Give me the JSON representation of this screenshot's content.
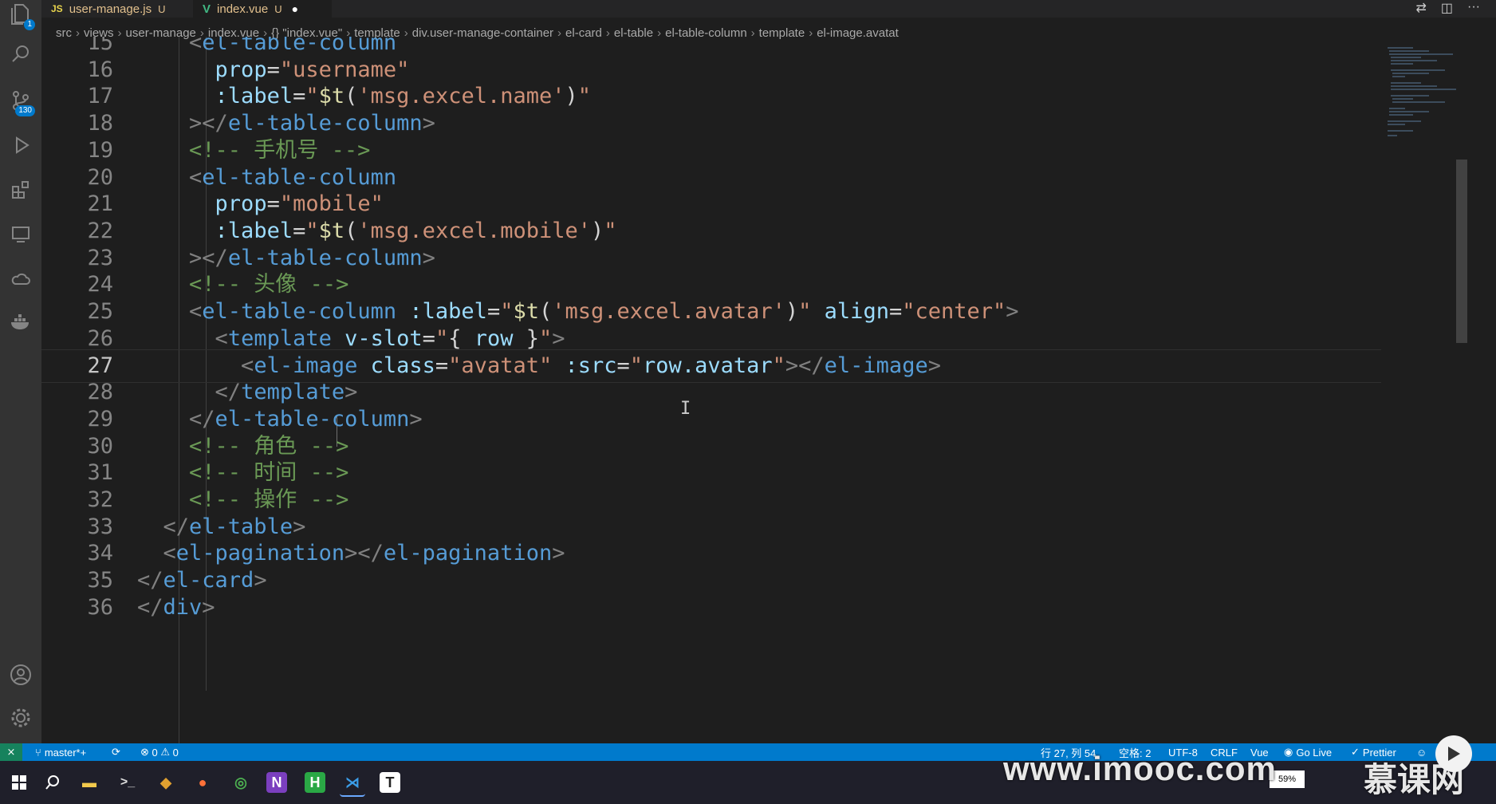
{
  "tabs": [
    {
      "name": "user-manage.js",
      "status": "U",
      "icon": "js",
      "active": false
    },
    {
      "name": "index.vue",
      "status": "U",
      "icon": "vue",
      "active": true,
      "modified": true
    }
  ],
  "breadcrumb": [
    "src",
    "views",
    "user-manage",
    "index.vue",
    "{} \"index.vue\"",
    "template",
    "div.user-manage-container",
    "el-card",
    "el-table",
    "el-table-column",
    "template",
    "el-image.avatat"
  ],
  "activity": {
    "explorer_badge": "1",
    "scm_badge": "130"
  },
  "code_lines": [
    {
      "n": "15",
      "parts": [
        [
          "ws",
          "    "
        ],
        [
          "punc",
          "<"
        ],
        [
          "tag",
          "el-table-column"
        ]
      ]
    },
    {
      "n": "16",
      "parts": [
        [
          "ws",
          "      "
        ],
        [
          "attr",
          "prop"
        ],
        [
          "op",
          "="
        ],
        [
          "str",
          "\"username\""
        ]
      ]
    },
    {
      "n": "17",
      "parts": [
        [
          "ws",
          "      "
        ],
        [
          "attr",
          ":label"
        ],
        [
          "op",
          "="
        ],
        [
          "str",
          "\""
        ],
        [
          "fn",
          "$t"
        ],
        [
          "op",
          "("
        ],
        [
          "str",
          "'msg.excel.name'"
        ],
        [
          "op",
          ")"
        ],
        [
          "str",
          "\""
        ]
      ]
    },
    {
      "n": "18",
      "parts": [
        [
          "ws",
          "    "
        ],
        [
          "punc",
          "></"
        ],
        [
          "tag",
          "el-table-column"
        ],
        [
          "punc",
          ">"
        ]
      ]
    },
    {
      "n": "19",
      "parts": [
        [
          "ws",
          "    "
        ],
        [
          "cmt",
          "<!-- 手机号 -->"
        ]
      ]
    },
    {
      "n": "20",
      "parts": [
        [
          "ws",
          "    "
        ],
        [
          "punc",
          "<"
        ],
        [
          "tag",
          "el-table-column"
        ]
      ]
    },
    {
      "n": "21",
      "parts": [
        [
          "ws",
          "      "
        ],
        [
          "attr",
          "prop"
        ],
        [
          "op",
          "="
        ],
        [
          "str",
          "\"mobile\""
        ]
      ]
    },
    {
      "n": "22",
      "parts": [
        [
          "ws",
          "      "
        ],
        [
          "attr",
          ":label"
        ],
        [
          "op",
          "="
        ],
        [
          "str",
          "\""
        ],
        [
          "fn",
          "$t"
        ],
        [
          "op",
          "("
        ],
        [
          "str",
          "'msg.excel.mobile'"
        ],
        [
          "op",
          ")"
        ],
        [
          "str",
          "\""
        ]
      ]
    },
    {
      "n": "23",
      "parts": [
        [
          "ws",
          "    "
        ],
        [
          "punc",
          "></"
        ],
        [
          "tag",
          "el-table-column"
        ],
        [
          "punc",
          ">"
        ]
      ]
    },
    {
      "n": "24",
      "parts": [
        [
          "ws",
          "    "
        ],
        [
          "cmt",
          "<!-- 头像 -->"
        ]
      ]
    },
    {
      "n": "25",
      "parts": [
        [
          "ws",
          "    "
        ],
        [
          "punc",
          "<"
        ],
        [
          "tag",
          "el-table-column"
        ],
        [
          "op",
          " "
        ],
        [
          "attr",
          ":label"
        ],
        [
          "op",
          "="
        ],
        [
          "str",
          "\""
        ],
        [
          "fn",
          "$t"
        ],
        [
          "op",
          "("
        ],
        [
          "str",
          "'msg.excel.avatar'"
        ],
        [
          "op",
          ")"
        ],
        [
          "str",
          "\""
        ],
        [
          "op",
          " "
        ],
        [
          "attr",
          "align"
        ],
        [
          "op",
          "="
        ],
        [
          "str",
          "\"center\""
        ],
        [
          "punc",
          ">"
        ]
      ]
    },
    {
      "n": "26",
      "parts": [
        [
          "ws",
          "      "
        ],
        [
          "punc",
          "<"
        ],
        [
          "tag",
          "template"
        ],
        [
          "op",
          " "
        ],
        [
          "attr",
          "v-slot"
        ],
        [
          "op",
          "="
        ],
        [
          "str",
          "\""
        ],
        [
          "op",
          "{ "
        ],
        [
          "attr",
          "row"
        ],
        [
          "op",
          " }"
        ],
        [
          "str",
          "\""
        ],
        [
          "punc",
          ">"
        ]
      ]
    },
    {
      "n": "27",
      "parts": [
        [
          "ws",
          "        "
        ],
        [
          "punc",
          "<"
        ],
        [
          "tag",
          "el-image"
        ],
        [
          "op",
          " "
        ],
        [
          "attr",
          "class"
        ],
        [
          "op",
          "="
        ],
        [
          "str",
          "\"avatat\""
        ],
        [
          "op",
          " "
        ],
        [
          "attr",
          ":src"
        ],
        [
          "op",
          "="
        ],
        [
          "str",
          "\""
        ],
        [
          "attr",
          "row.avatar"
        ],
        [
          "str",
          "\""
        ],
        [
          "punc",
          "></"
        ],
        [
          "tag",
          "el-image"
        ],
        [
          "punc",
          ">"
        ]
      ],
      "current": true
    },
    {
      "n": "28",
      "parts": [
        [
          "ws",
          "      "
        ],
        [
          "punc",
          "</"
        ],
        [
          "tag",
          "template"
        ],
        [
          "punc",
          ">"
        ]
      ]
    },
    {
      "n": "29",
      "parts": [
        [
          "ws",
          "    "
        ],
        [
          "punc",
          "</"
        ],
        [
          "tag",
          "el-table-column"
        ],
        [
          "punc",
          ">"
        ]
      ]
    },
    {
      "n": "30",
      "parts": [
        [
          "ws",
          "    "
        ],
        [
          "cmt",
          "<!-- 角色 -->"
        ]
      ]
    },
    {
      "n": "31",
      "parts": [
        [
          "ws",
          "    "
        ],
        [
          "cmt",
          "<!-- 时间 -->"
        ]
      ]
    },
    {
      "n": "32",
      "parts": [
        [
          "ws",
          "    "
        ],
        [
          "cmt",
          "<!-- 操作 -->"
        ]
      ]
    },
    {
      "n": "33",
      "parts": [
        [
          "ws",
          "  "
        ],
        [
          "punc",
          "</"
        ],
        [
          "tag",
          "el-table"
        ],
        [
          "punc",
          ">"
        ]
      ]
    },
    {
      "n": "34",
      "parts": [
        [
          "ws",
          "  "
        ],
        [
          "punc",
          "<"
        ],
        [
          "tag",
          "el-pagination"
        ],
        [
          "punc",
          "></"
        ],
        [
          "tag",
          "el-pagination"
        ],
        [
          "punc",
          ">"
        ]
      ]
    },
    {
      "n": "35",
      "parts": [
        [
          "ws",
          ""
        ],
        [
          "punc",
          "</"
        ],
        [
          "tag",
          "el-card"
        ],
        [
          "punc",
          ">"
        ]
      ]
    },
    {
      "n": "36",
      "parts": [
        [
          "ws",
          ""
        ],
        [
          "punc",
          "</"
        ],
        [
          "tag",
          "div"
        ],
        [
          "punc",
          ">"
        ]
      ]
    }
  ],
  "status": {
    "branch": "master*+",
    "errors": "0",
    "warnings": "0",
    "position": "行 27, 列 54",
    "spaces": "空格: 2",
    "encoding": "UTF-8",
    "eol": "CRLF",
    "language": "Vue",
    "golive": "Go Live",
    "prettier": "Prettier"
  },
  "taskbar": {
    "battery": "59%"
  },
  "watermark": {
    "url": "www.imooc.com",
    "brand": "慕课网"
  },
  "colors": {
    "statusbar": "#007acc",
    "activity": "#333333",
    "editor_bg": "#1e1e1e"
  }
}
